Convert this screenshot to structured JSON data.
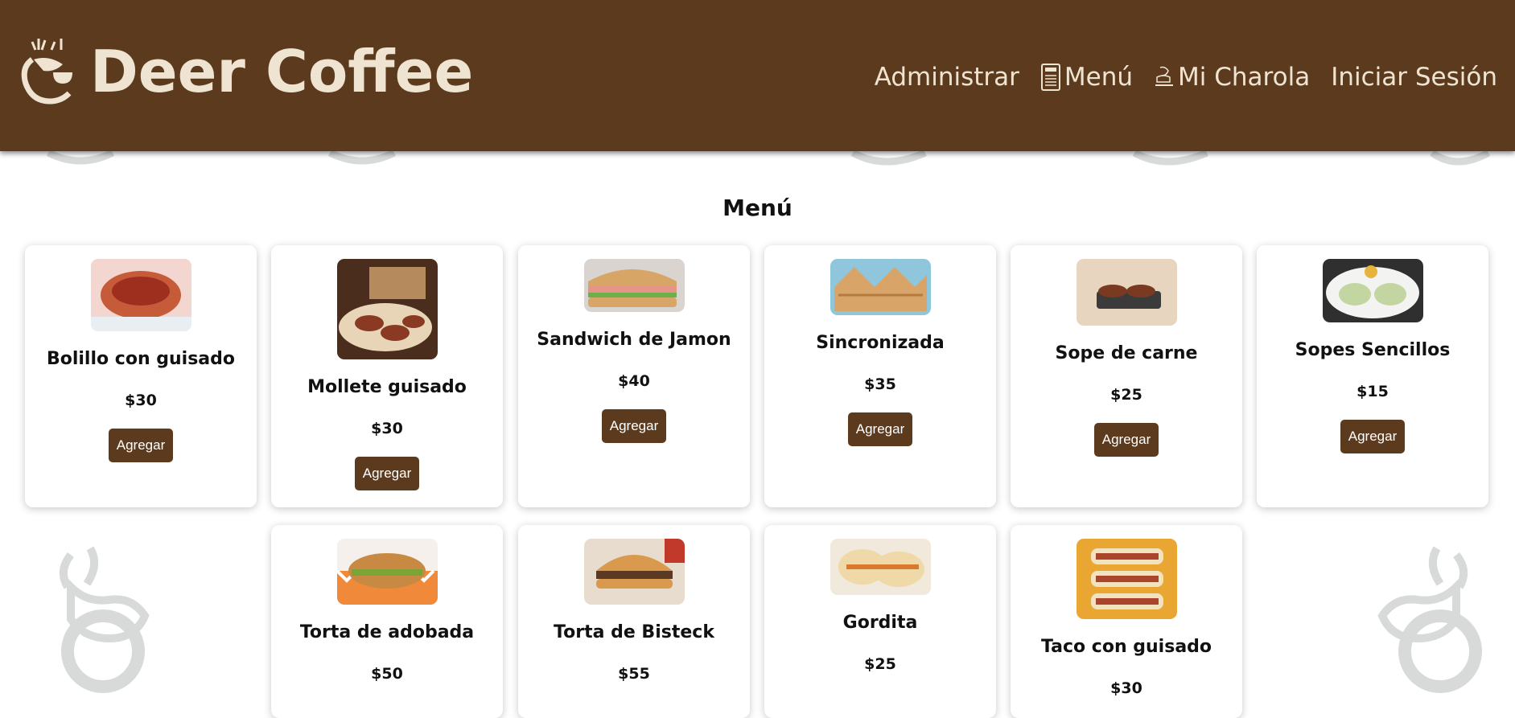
{
  "header": {
    "brand": "Deer Coffee",
    "nav": [
      {
        "label": "Administrar",
        "icon": ""
      },
      {
        "label": "Menú",
        "icon": "menu-book-icon"
      },
      {
        "label": "Mi Charola",
        "icon": "tray-icon"
      },
      {
        "label": "Iniciar Sesión",
        "icon": ""
      }
    ]
  },
  "main": {
    "title": "Menú",
    "add_label": "Agregar",
    "products": [
      {
        "name": "Bolillo con guisado",
        "price": "$30"
      },
      {
        "name": "Mollete guisado",
        "price": "$30"
      },
      {
        "name": "Sandwich de Jamon",
        "price": "$40"
      },
      {
        "name": "Sincronizada",
        "price": "$35"
      },
      {
        "name": "Sope de carne",
        "price": "$25"
      },
      {
        "name": "Sopes Sencillos",
        "price": "$15"
      },
      {
        "name": "Torta de adobada",
        "price": "$50"
      },
      {
        "name": "Torta de Bisteck",
        "price": "$55"
      },
      {
        "name": "Gordita",
        "price": "$25"
      },
      {
        "name": "Taco con guisado",
        "price": "$30"
      }
    ]
  },
  "colors": {
    "brand_brown": "#5c3a1e",
    "brand_cream": "#efe4d2"
  }
}
